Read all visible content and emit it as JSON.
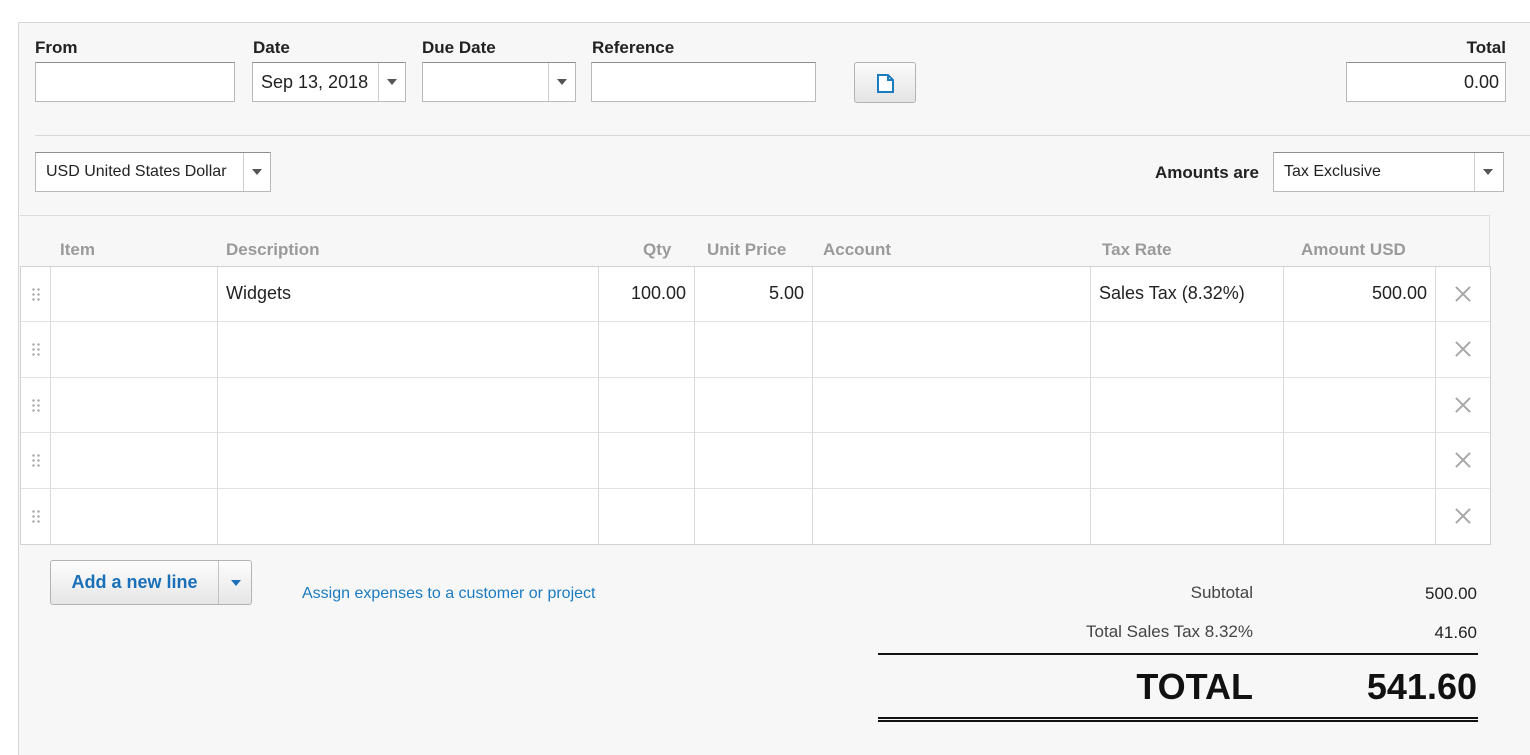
{
  "header": {
    "from_label": "From",
    "from_value": "",
    "date_label": "Date",
    "date_value": "Sep 13, 2018",
    "due_date_label": "Due Date",
    "due_date_value": "",
    "reference_label": "Reference",
    "reference_value": "",
    "total_label": "Total",
    "total_value": "0.00"
  },
  "currency": {
    "value": "USD United States Dollar"
  },
  "amounts": {
    "label": "Amounts are",
    "value": "Tax Exclusive"
  },
  "columns": {
    "item": "Item",
    "description": "Description",
    "qty": "Qty",
    "unit_price": "Unit Price",
    "account": "Account",
    "tax_rate": "Tax Rate",
    "amount": "Amount USD"
  },
  "lines": [
    {
      "item": "",
      "description": "Widgets",
      "qty": "100.00",
      "unit_price": "5.00",
      "account": "",
      "tax_rate": "Sales Tax (8.32%)",
      "amount": "500.00"
    },
    {
      "item": "",
      "description": "",
      "qty": "",
      "unit_price": "",
      "account": "",
      "tax_rate": "",
      "amount": ""
    },
    {
      "item": "",
      "description": "",
      "qty": "",
      "unit_price": "",
      "account": "",
      "tax_rate": "",
      "amount": ""
    },
    {
      "item": "",
      "description": "",
      "qty": "",
      "unit_price": "",
      "account": "",
      "tax_rate": "",
      "amount": ""
    },
    {
      "item": "",
      "description": "",
      "qty": "",
      "unit_price": "",
      "account": "",
      "tax_rate": "",
      "amount": ""
    }
  ],
  "actions": {
    "add_line": "Add a new line",
    "assign_link": "Assign expenses to a customer or project"
  },
  "summary": {
    "subtotal_label": "Subtotal",
    "subtotal_value": "500.00",
    "tax_label": "Total Sales Tax 8.32%",
    "tax_value": "41.60",
    "total_label": "TOTAL",
    "total_value": "541.60"
  },
  "colors": {
    "link": "#1a7bc0",
    "button_text": "#1a70b8",
    "header_text": "#9a9a9a"
  }
}
